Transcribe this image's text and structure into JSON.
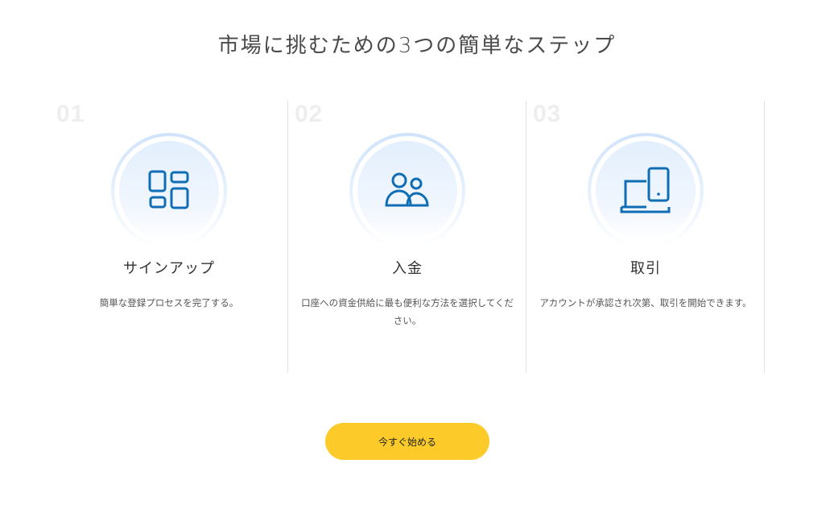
{
  "page": {
    "title": "市場に挑むための3つの簡単なステップ"
  },
  "steps": [
    {
      "number": "01",
      "icon": "dashboard-grid-icon",
      "title": "サインアップ",
      "description": "簡単な登録プロセスを完了する。"
    },
    {
      "number": "02",
      "icon": "users-icon",
      "title": "入金",
      "description": "口座への資金供給に最も便利な方法を選択してください。"
    },
    {
      "number": "03",
      "icon": "laptop-phone-icon",
      "title": "取引",
      "description": "アカウントが承認され次第、取引を開始できます。"
    }
  ],
  "cta": {
    "label": "今すぐ始める"
  },
  "colors": {
    "icon_stroke": "#0f6db5",
    "cta_background": "#fccb29",
    "divider": "#e3e3e3",
    "step_number": "#eeeeee"
  }
}
